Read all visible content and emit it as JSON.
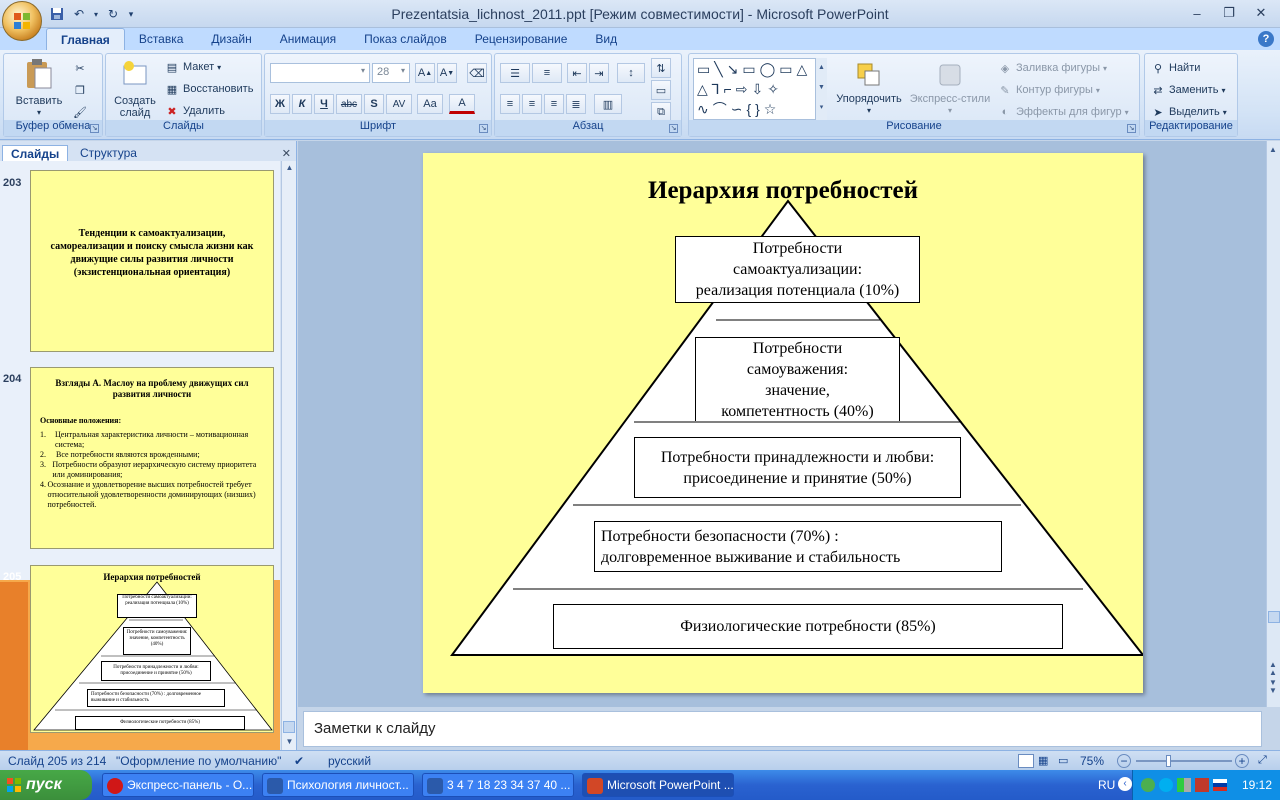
{
  "window": {
    "title": "Prezentatsia_lichnost_2011.ppt [Режим совместимости] - Microsoft PowerPoint",
    "minimize": "–",
    "maximize": "❐",
    "close": "✕"
  },
  "tabs": [
    "Главная",
    "Вставка",
    "Дизайн",
    "Анимация",
    "Показ слайдов",
    "Рецензирование",
    "Вид"
  ],
  "ribbon": {
    "clipboard": {
      "paste": "Вставить",
      "label": "Буфер обмена"
    },
    "slides": {
      "new_slide": "Создать слайд",
      "layout": "Макет",
      "reset": "Восстановить",
      "delete": "Удалить",
      "label": "Слайды"
    },
    "font": {
      "font_size": "28",
      "label": "Шрифт",
      "bold": "Ж",
      "italic": "К",
      "underline": "Ч",
      "strike": "abc",
      "shadow": "S",
      "spacing": "AV",
      "case": "Aa",
      "color": "A"
    },
    "paragraph": {
      "label": "Абзац"
    },
    "drawing": {
      "arrange": "Упорядочить",
      "quick_styles": "Экспресс-стили",
      "fill": "Заливка фигуры",
      "outline": "Контур фигуры",
      "effects": "Эффекты для фигур",
      "label": "Рисование"
    },
    "editing": {
      "find": "Найти",
      "replace": "Заменить",
      "select": "Выделить",
      "label": "Редактирование"
    }
  },
  "left_panel": {
    "tab_slides": "Слайды",
    "tab_outline": "Структура",
    "thumbs": [
      {
        "num": "203",
        "text": "Тенденции к самоактуализации, самореализации и поиску смысла жизни как движущие силы развития личности (экзистенциональная ориентация)"
      },
      {
        "num": "204",
        "title": "Взгляды А. Маслоу на проблему движущих сил развития личности",
        "subtitle": "Основные положения:",
        "items": [
          "Центральная характеристика личности – мотивационная система;",
          "Все потребности являются врожденными;",
          "Потребности образуют иерархическую систему приоритета или доминирования;",
          "Осознание и удовлетворение высших потребностей требует относительной удовлетворенности доминирующих (низших) потребностей."
        ]
      },
      {
        "num": "205",
        "title": "Иерархия потребностей"
      }
    ]
  },
  "slide": {
    "title": "Иерархия потребностей",
    "levels": [
      {
        "lines": [
          "Потребности",
          "самоактуализации:",
          "реализация потенциала (10%)"
        ]
      },
      {
        "lines": [
          "Потребности",
          "самоуважения:",
          "значение,",
          "компетентность (40%)"
        ]
      },
      {
        "lines": [
          "Потребности принадлежности и любви:",
          "присоединение и принятие (50%)"
        ]
      },
      {
        "lines": [
          "Потребности безопасности (70%) :",
          "долговременное выживание и стабильность"
        ]
      },
      {
        "lines": [
          "Физиологические потребности  (85%)"
        ]
      }
    ],
    "thumb_levels": [
      "Потребности самоактуализации: реализация потенциала (10%)",
      "Потребности самоуважения: значение, компетентность (40%)",
      "Потребности принадлежности и любви: присоединение и принятие (50%)",
      "Потребности безопасности (70%) : долговременное выживание и стабильность",
      "Физиологические потребности  (85%)"
    ]
  },
  "notes": {
    "placeholder": "Заметки к слайду"
  },
  "status": {
    "slide": "Слайд 205 из 214",
    "theme": "\"Оформление по умолчанию\"",
    "language": "русский",
    "zoom": "75%"
  },
  "taskbar": {
    "start": "пуск",
    "tasks": [
      "Экспресс-панель - О...",
      "Психология личност...",
      "3 4 7 18 23 34 37 40 ...",
      "Microsoft PowerPoint ..."
    ],
    "lang": "RU",
    "clock": "19:12"
  }
}
